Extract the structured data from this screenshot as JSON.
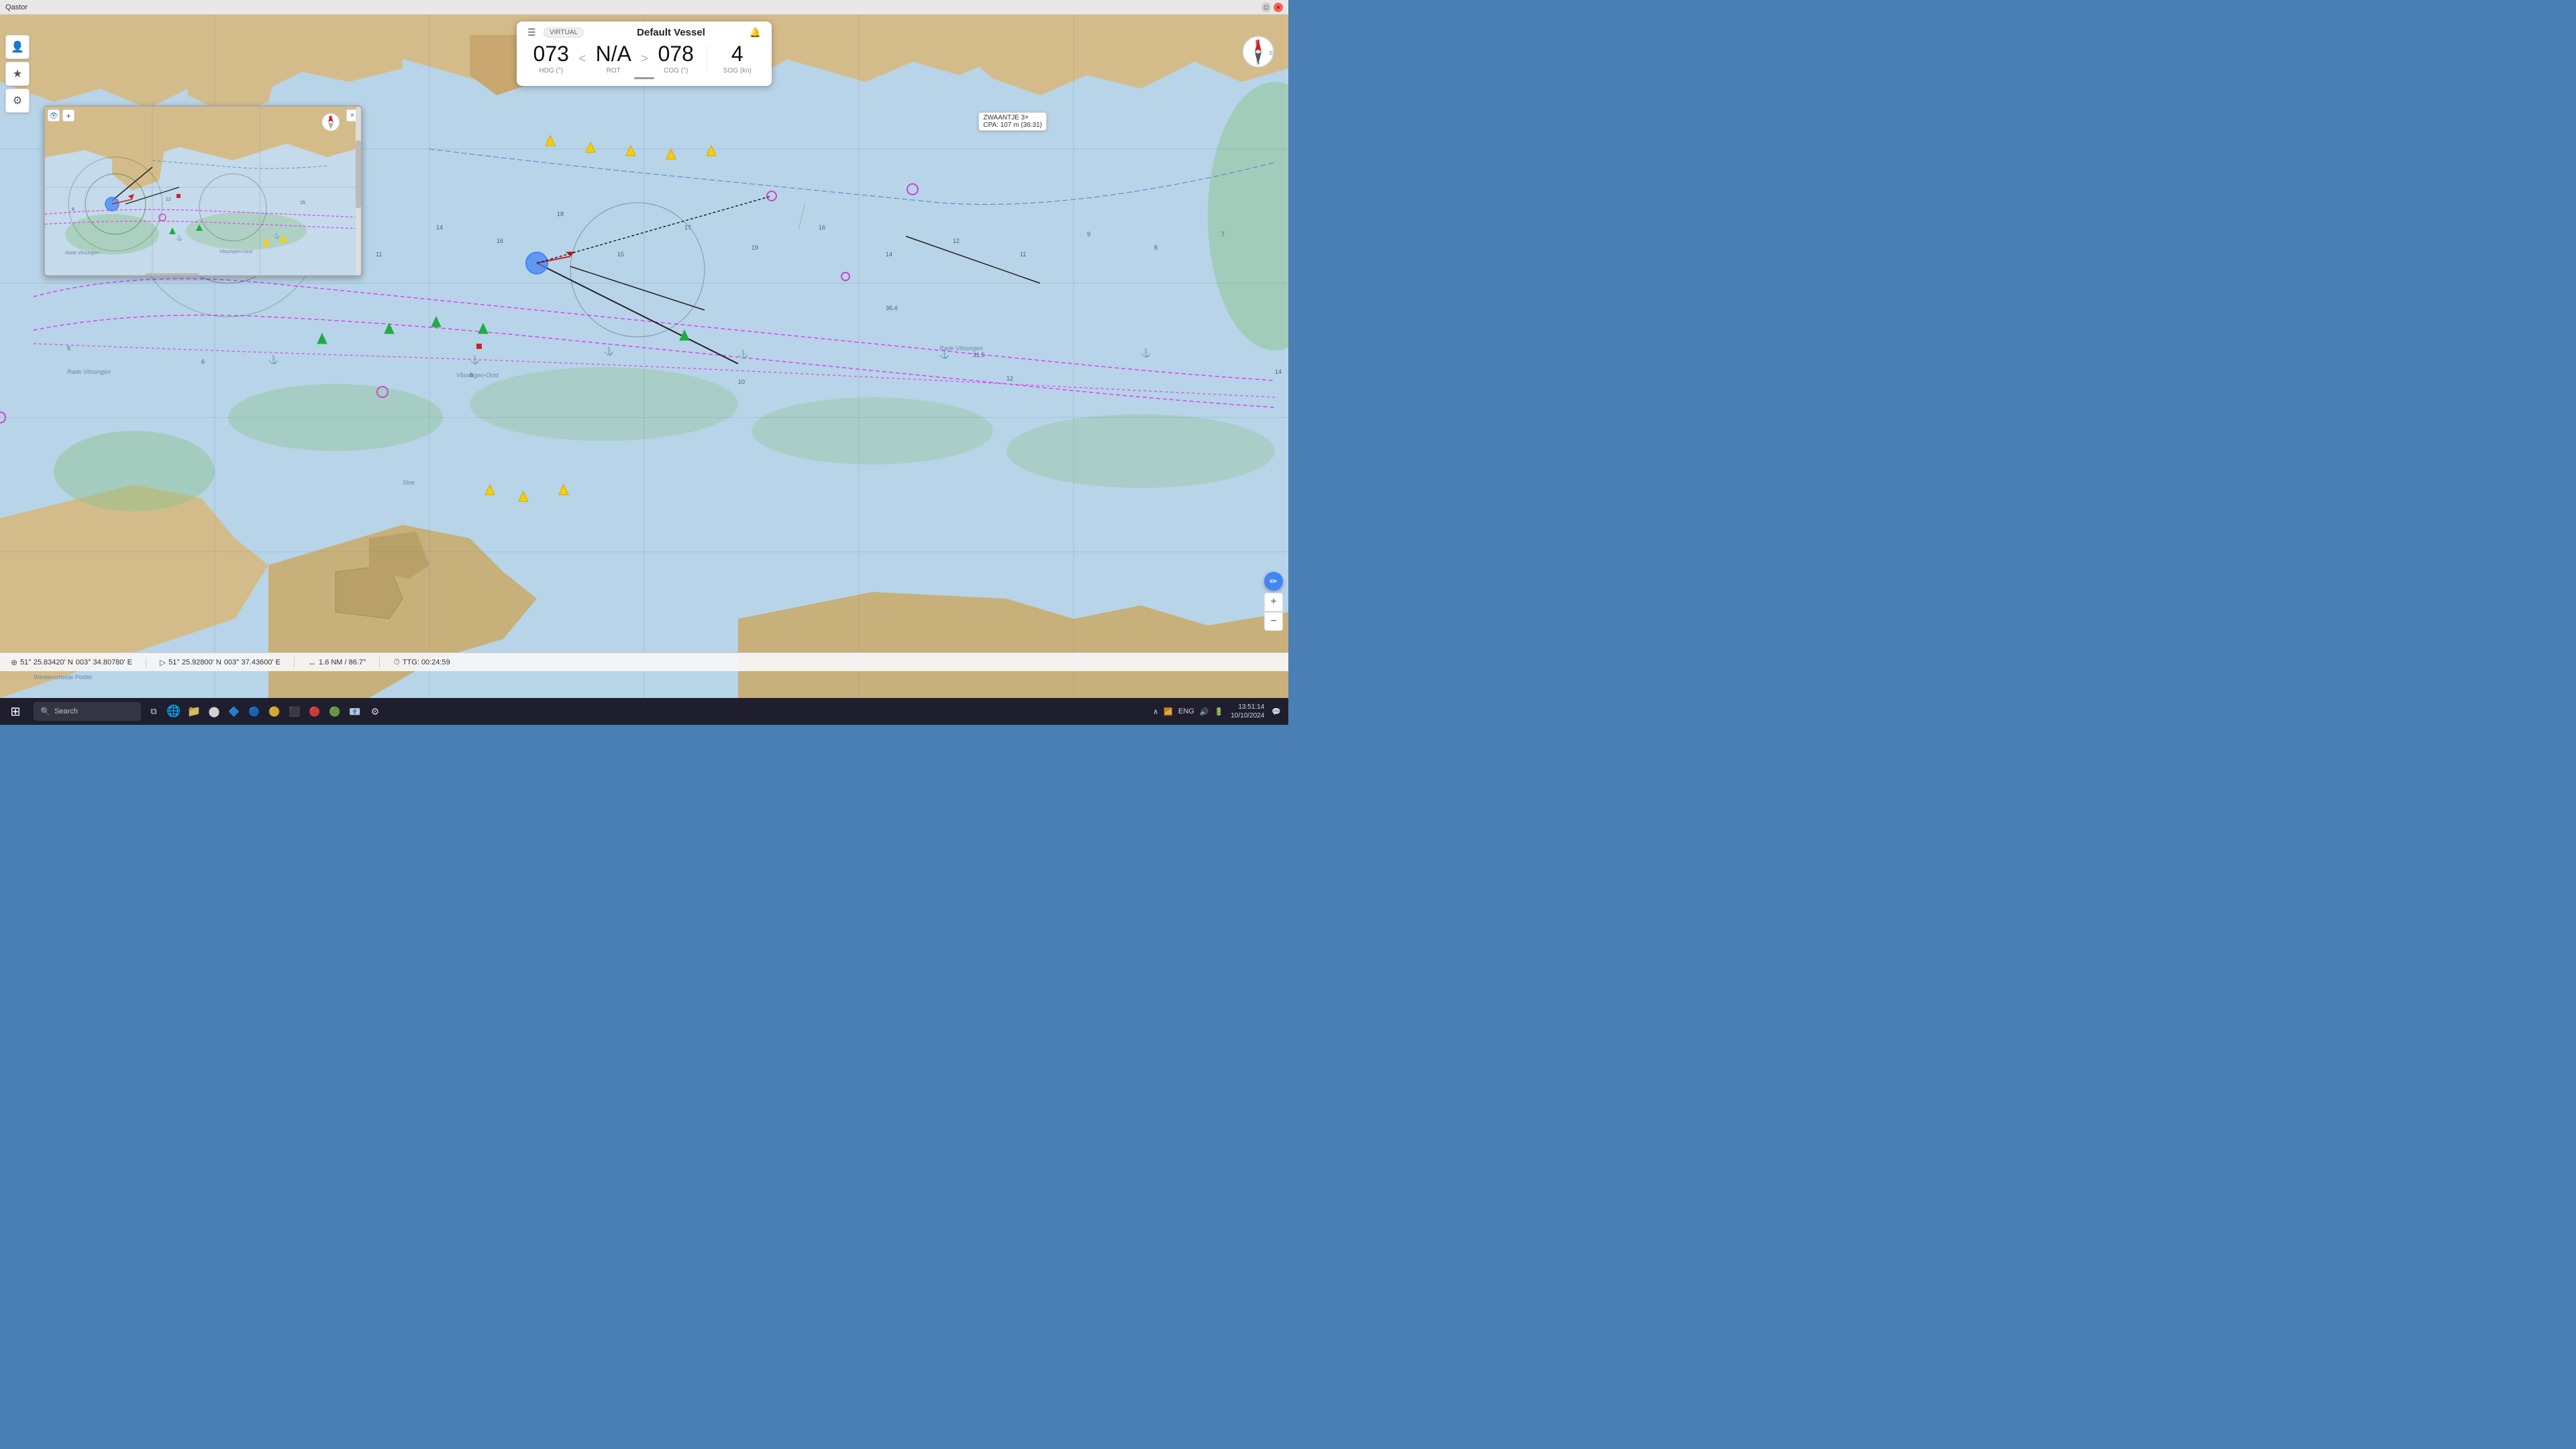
{
  "titlebar": {
    "title": "Qastor",
    "close_label": "×",
    "maximize_label": "□"
  },
  "vessel_panel": {
    "title": "Default Vessel",
    "virtual_badge": "VIRTUAL",
    "hdg_value": "073",
    "hdg_label": "HDG (°)",
    "rot_value": "N/A",
    "rot_label": "ROT",
    "cog_value": "078",
    "cog_label": "COG (°)",
    "sog_value": "4",
    "sog_label": "SOG (kn)"
  },
  "status_bar": {
    "pos1_icon": "⊕",
    "pos1_lat": "51° 25.83420' N",
    "pos1_lon": "003° 34.80780' E",
    "pos2_icon": "▷",
    "pos2_lat": "51° 25.92800' N",
    "pos2_lon": "003° 37.43600' E",
    "speed_icon": "↔",
    "speed_value": "1.6 NM / 86.7°",
    "ttg_icon": "⏱",
    "ttg_value": "TTG: 00:24:59"
  },
  "vessel_tooltip": {
    "name": "ZWAANTJE 3+",
    "cpa": "CPA: 107 m (36:31)"
  },
  "taskbar": {
    "search_placeholder": "Search",
    "time": "13:51:14",
    "date": "10/10/2024",
    "lang": "ENG",
    "start_icon": "⊞"
  },
  "toolbar": {
    "person_icon": "👤",
    "star_icon": "★",
    "settings_icon": "⚙"
  },
  "map": {
    "mini_map_label": "Rade Vlissingen",
    "area_labels": [
      "Rade Vlissingen",
      "Vlissingen-Oost",
      "Sloe"
    ]
  },
  "north_compass": {
    "label": "N"
  },
  "zoom": {
    "plus": "+",
    "minus": "−"
  }
}
